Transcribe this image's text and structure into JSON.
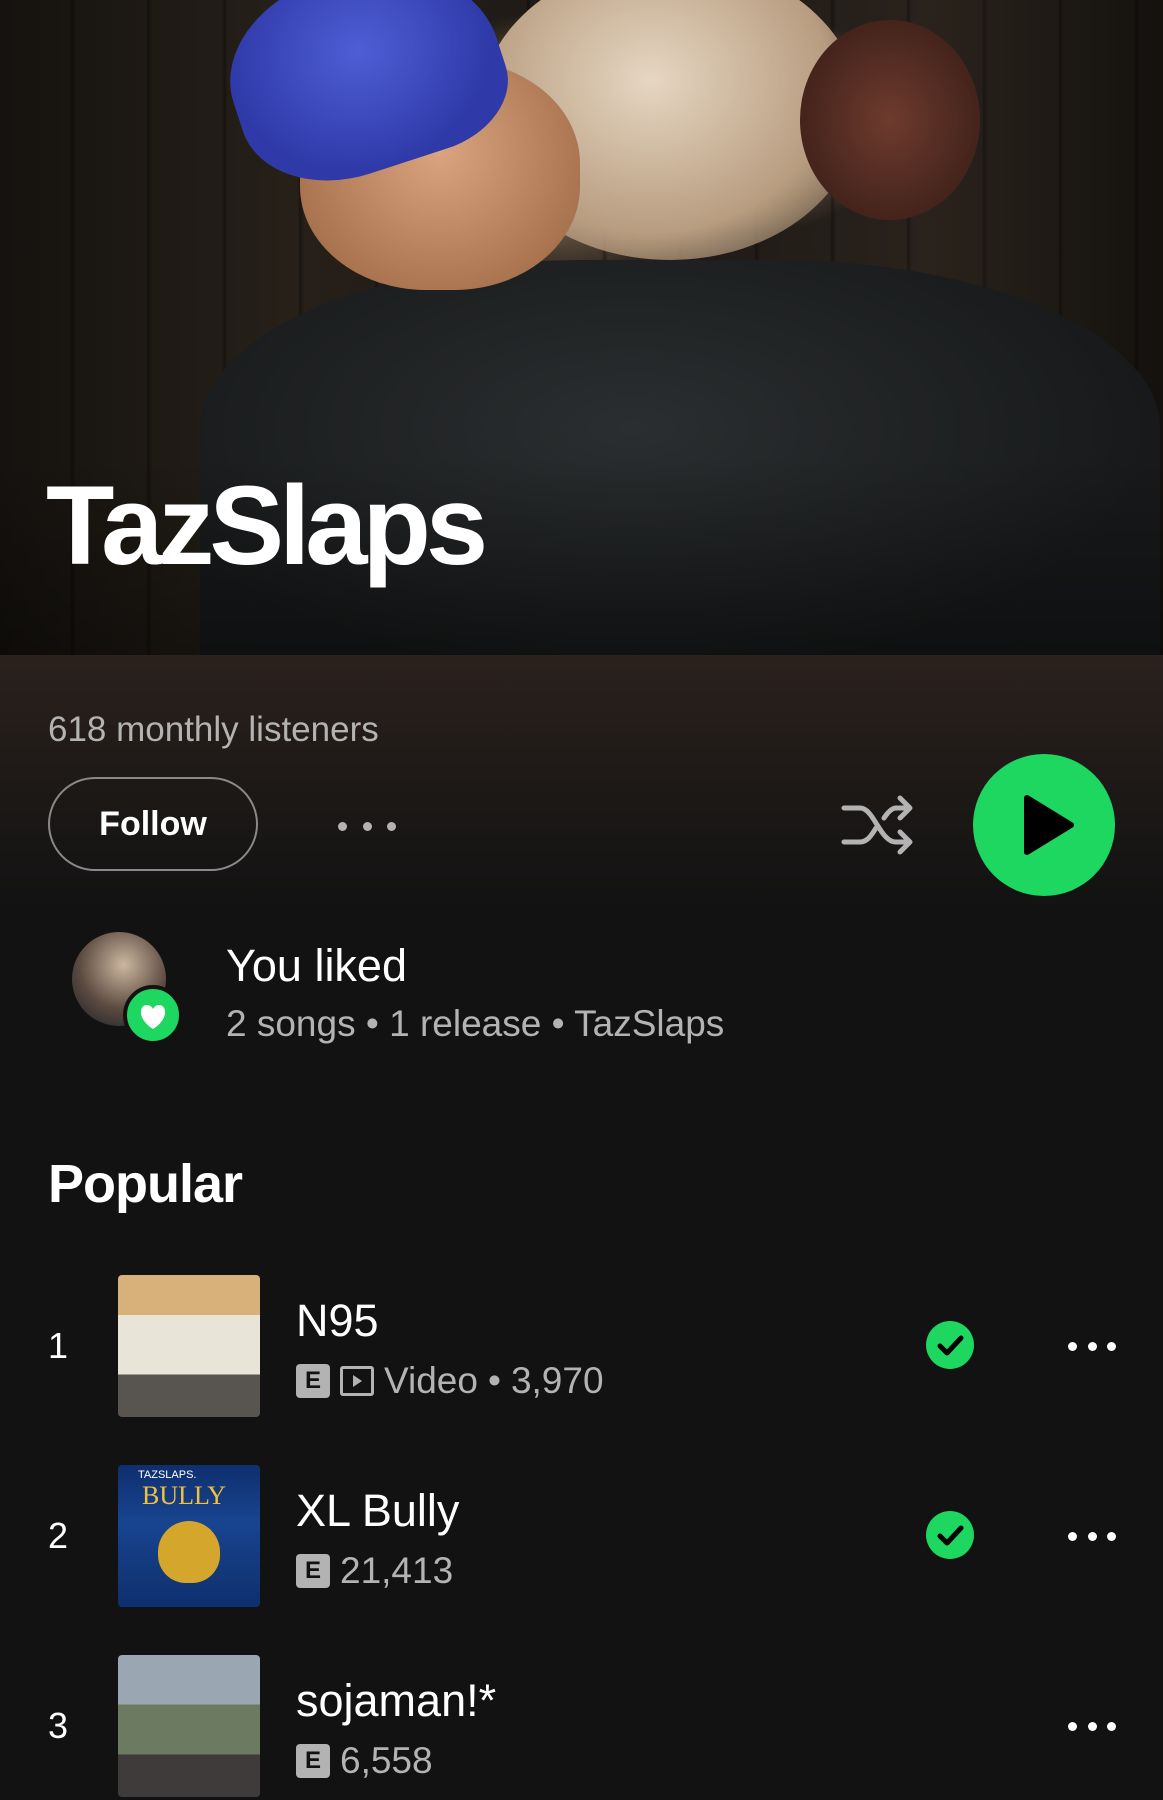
{
  "artist": {
    "name": "TazSlaps",
    "monthly_listeners": "618 monthly listeners"
  },
  "actions": {
    "follow_label": "Follow"
  },
  "liked": {
    "title": "You liked",
    "subtitle": "2 songs • 1 release • TazSlaps"
  },
  "popular": {
    "title": "Popular",
    "tracks": [
      {
        "rank": "1",
        "title": "N95",
        "explicit": "E",
        "video_label": "Video",
        "plays": "3,970",
        "liked": true
      },
      {
        "rank": "2",
        "title": "XL Bully",
        "explicit": "E",
        "plays": "21,413",
        "liked": true
      },
      {
        "rank": "3",
        "title": "sojaman!*",
        "explicit": "E",
        "plays": "6,558",
        "liked": false
      }
    ]
  },
  "album_art_text": {
    "track2_top": "TAZSLAPS.",
    "track2_title": "BULLY"
  },
  "colors": {
    "accent_green": "#1ed760",
    "background": "#121212",
    "secondary_text": "#b3b3b3"
  },
  "icons": [
    "more-options-icon",
    "shuffle-icon",
    "play-icon",
    "heart-icon",
    "explicit-icon",
    "video-icon",
    "check-icon"
  ]
}
